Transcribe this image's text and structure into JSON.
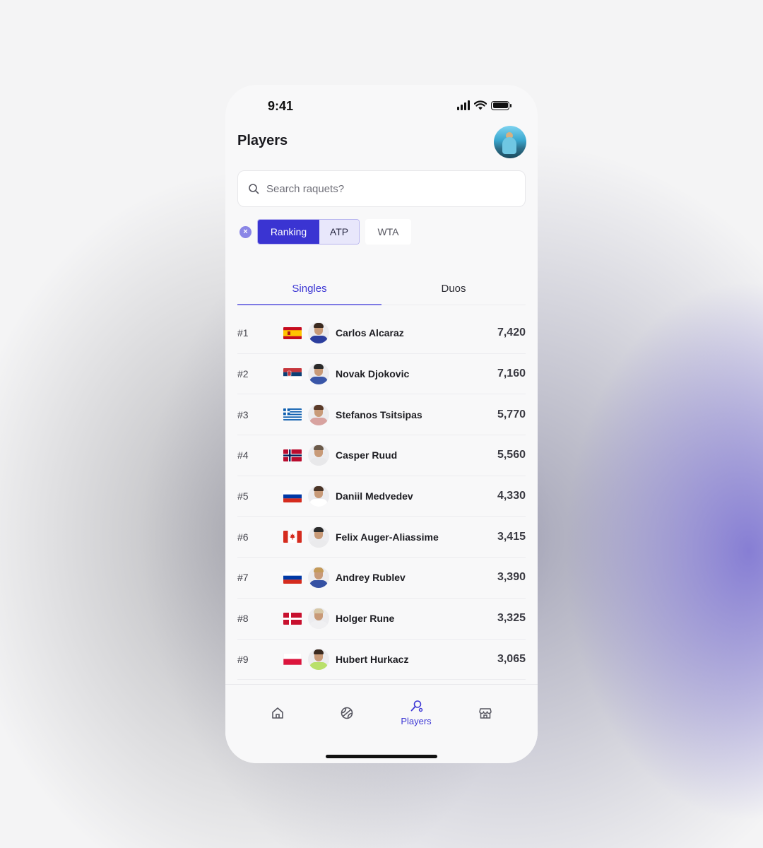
{
  "status_bar": {
    "time": "9:41"
  },
  "header": {
    "title": "Players"
  },
  "search": {
    "placeholder": "Search raquets?"
  },
  "filters": {
    "active": "Ranking",
    "secondary": "ATP",
    "chip": "WTA"
  },
  "tabs": [
    {
      "label": "Singles",
      "active": true
    },
    {
      "label": "Duos",
      "active": false
    }
  ],
  "players": [
    {
      "rank": "#1",
      "flag": "spain",
      "name": "Carlos Alcaraz",
      "points": "7,420"
    },
    {
      "rank": "#2",
      "flag": "serbia",
      "name": "Novak Djokovic",
      "points": "7,160"
    },
    {
      "rank": "#3",
      "flag": "greece",
      "name": "Stefanos Tsitsipas",
      "points": "5,770"
    },
    {
      "rank": "#4",
      "flag": "norway",
      "name": "Casper Ruud",
      "points": "5,560"
    },
    {
      "rank": "#5",
      "flag": "russia",
      "name": "Daniil Medvedev",
      "points": "4,330"
    },
    {
      "rank": "#6",
      "flag": "canada",
      "name": "Felix Auger-Aliassime",
      "points": "3,415"
    },
    {
      "rank": "#7",
      "flag": "russia",
      "name": "Andrey Rublev",
      "points": "3,390"
    },
    {
      "rank": "#8",
      "flag": "denmark",
      "name": "Holger Rune",
      "points": "3,325"
    },
    {
      "rank": "#9",
      "flag": "poland",
      "name": "Hubert Hurkacz",
      "points": "3,065"
    }
  ],
  "tabbar": {
    "items": [
      {
        "icon": "home-icon",
        "label": ""
      },
      {
        "icon": "tennis-ball-icon",
        "label": ""
      },
      {
        "icon": "racket-icon",
        "label": "Players",
        "active": true
      },
      {
        "icon": "store-icon",
        "label": ""
      }
    ]
  },
  "colors": {
    "accent": "#3a34d2",
    "accent_light": "#e8e7fb",
    "background": "#f8f8f9"
  }
}
